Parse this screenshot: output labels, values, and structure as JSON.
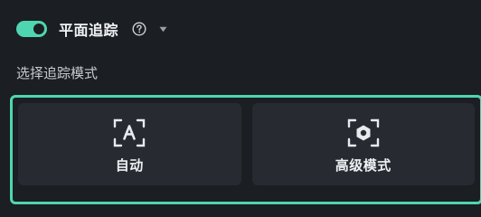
{
  "header": {
    "toggle_on": true,
    "title": "平面追踪",
    "help_icon": "question-circle-icon",
    "dropdown_icon": "caret-down-icon"
  },
  "mode_section": {
    "label": "选择追踪模式",
    "options": [
      {
        "label": "自动",
        "icon": "auto-a-focus-icon"
      },
      {
        "label": "高级模式",
        "icon": "advanced-hexagon-focus-icon"
      }
    ]
  },
  "colors": {
    "accent": "#4fd6b1",
    "background": "#1b1e23",
    "button_bg": "#272b31",
    "text": "#eef0f3",
    "muted_text": "#c7cad0"
  }
}
